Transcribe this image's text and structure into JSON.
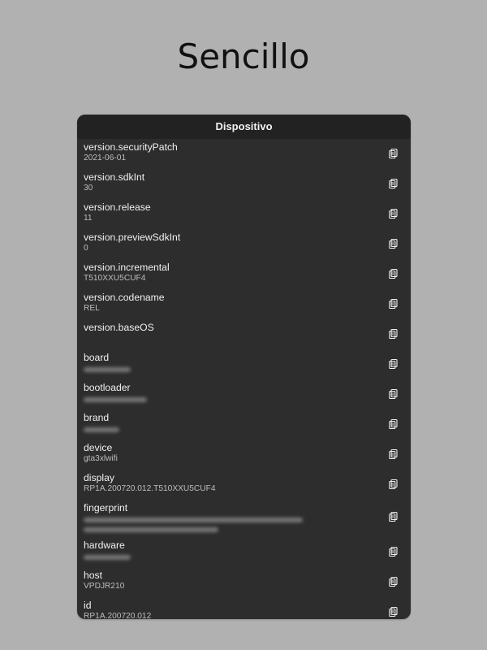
{
  "page": {
    "title": "Sencillo"
  },
  "panel": {
    "title": "Dispositivo"
  },
  "items": [
    {
      "label": "version.securityPatch",
      "value": "2021-06-01"
    },
    {
      "label": "version.sdkInt",
      "value": "30"
    },
    {
      "label": "version.release",
      "value": "11"
    },
    {
      "label": "version.previewSdkInt",
      "value": "0"
    },
    {
      "label": "version.incremental",
      "value": "T510XXU5CUF4"
    },
    {
      "label": "version.codename",
      "value": "REL"
    },
    {
      "label": "version.baseOS",
      "value": ""
    },
    {
      "label": "board",
      "value": ""
    },
    {
      "label": "bootloader",
      "value": ""
    },
    {
      "label": "brand",
      "value": ""
    },
    {
      "label": "device",
      "value": "gta3xlwifi"
    },
    {
      "label": "display",
      "value": "RP1A.200720.012.T510XXU5CUF4"
    },
    {
      "label": "fingerprint",
      "value": ""
    },
    {
      "label": "hardware",
      "value": ""
    },
    {
      "label": "host",
      "value": "VPDJR210"
    },
    {
      "label": "id",
      "value": "RP1A.200720.012"
    }
  ],
  "icons": {
    "copy": "copy-icon"
  },
  "colors": {
    "background": "#b1b1b1",
    "panel": "#2d2d2d",
    "header": "#222222",
    "text": "#f0f0f0",
    "subtext": "#bdbdbd"
  }
}
